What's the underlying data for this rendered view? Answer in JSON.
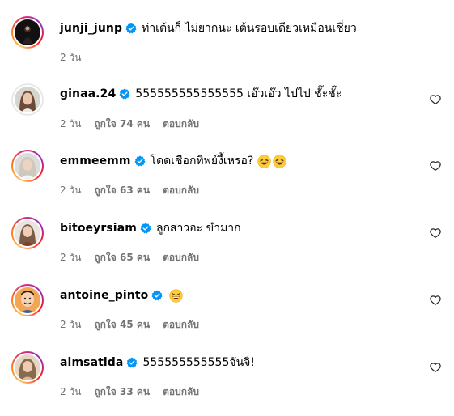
{
  "colors": {
    "text": "#000000",
    "meta": "#737373",
    "verified": "#0095f6"
  },
  "comments": [
    {
      "username": "junji_junp",
      "text": "ท่าเต้นก็ ไม่ยากนะ เต้นรอบเดียวเหมือนเชี่ยว",
      "time": "2 วัน",
      "likes": "",
      "reply": "",
      "verified": true,
      "emoji": []
    },
    {
      "username": "ginaa.24",
      "text": "555555555555555 เอ๊วเอ๊ว ไปไป ชั๊ะชั๊ะ",
      "time": "2 วัน",
      "likes": "ถูกใจ 74 คน",
      "reply": "ตอบกลับ",
      "verified": true,
      "emoji": []
    },
    {
      "username": "emmeemm",
      "text": "โดดเชือกทิพย์งี้เหรอ?",
      "time": "2 วัน",
      "likes": "ถูกใจ 63 คน",
      "reply": "ตอบกลับ",
      "verified": true,
      "emoji": [
        "grinning-squinting-face-icon",
        "grinning-squinting-face-icon"
      ]
    },
    {
      "username": "bitoeyrsiam",
      "text": "ลูกสาวอะ ขำมาก",
      "time": "2 วัน",
      "likes": "ถูกใจ 65 คน",
      "reply": "ตอบกลับ",
      "verified": true,
      "emoji": []
    },
    {
      "username": "antoine_pinto",
      "text": "",
      "time": "2 วัน",
      "likes": "ถูกใจ 45 คน",
      "reply": "ตอบกลับ",
      "verified": true,
      "emoji": [
        "grinning-squinting-face-icon"
      ]
    },
    {
      "username": "aimsatida",
      "text": "555555555555จันจิ!",
      "time": "2 วัน",
      "likes": "ถูกใจ 33 คน",
      "reply": "ตอบกลับ",
      "verified": true,
      "emoji": []
    }
  ]
}
